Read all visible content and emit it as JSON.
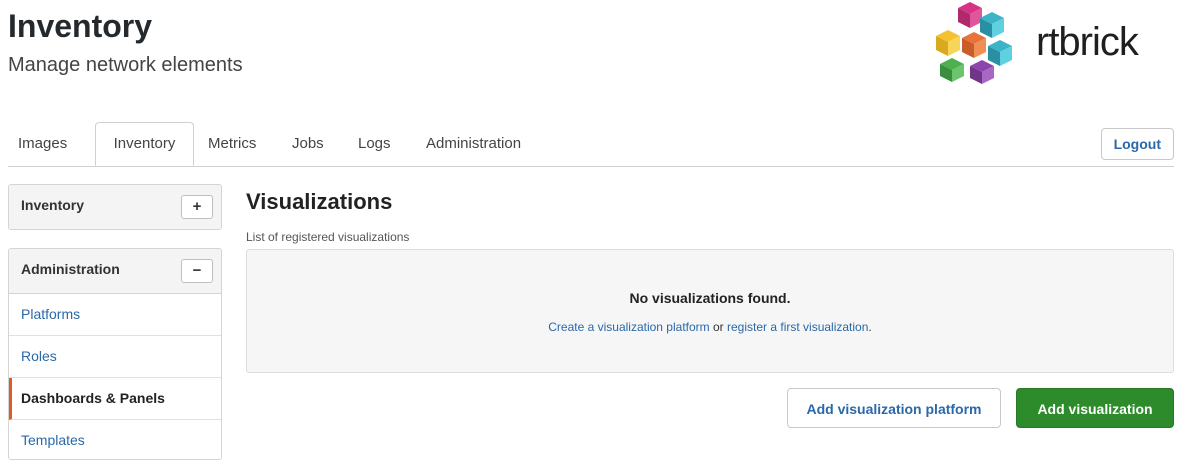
{
  "header": {
    "title": "Inventory",
    "subtitle": "Manage network elements"
  },
  "logo": {
    "text": "rtbrick"
  },
  "tabs": [
    {
      "label": "Images"
    },
    {
      "label": "Inventory",
      "active": true
    },
    {
      "label": "Metrics"
    },
    {
      "label": "Jobs"
    },
    {
      "label": "Logs"
    },
    {
      "label": "Administration"
    }
  ],
  "logout": {
    "label": "Logout"
  },
  "sidebar": {
    "inventory": {
      "title": "Inventory",
      "toggle": "+"
    },
    "administration": {
      "title": "Administration",
      "toggle": "−",
      "items": [
        {
          "label": "Platforms"
        },
        {
          "label": "Roles"
        },
        {
          "label": "Dashboards & Panels",
          "active": true
        },
        {
          "label": "Templates"
        }
      ]
    }
  },
  "main": {
    "title": "Visualizations",
    "description": "List of registered visualizations",
    "empty": {
      "title": "No visualizations found.",
      "link1": "Create a visualization platform",
      "or": " or ",
      "link2": "register a first visualization",
      "end": "."
    },
    "buttons": {
      "add_platform": "Add visualization platform",
      "add_visualization": "Add visualization"
    }
  },
  "colors": {
    "accent_link": "#2a68a8",
    "primary_button": "#2e8b2c",
    "active_marker": "#e05a22"
  }
}
